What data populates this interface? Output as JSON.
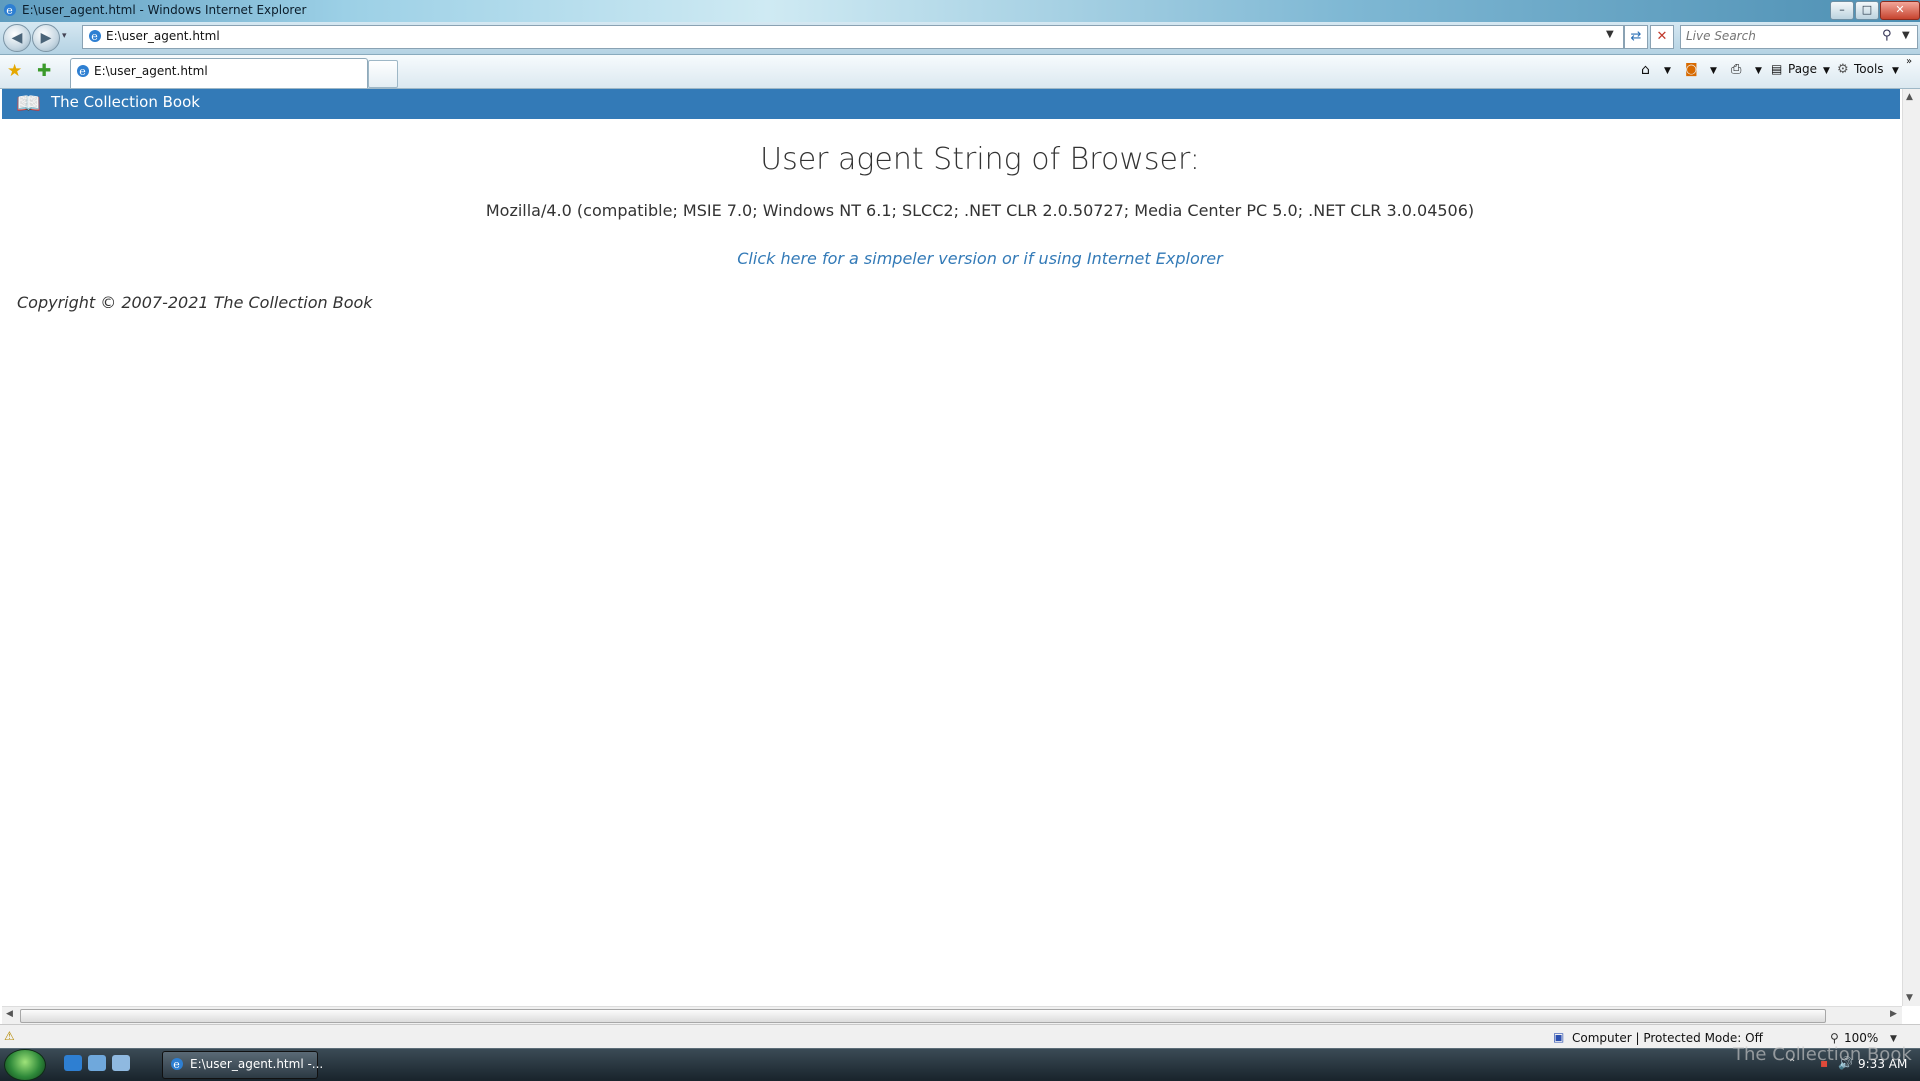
{
  "window": {
    "title": "E:\\user_agent.html - Windows Internet Explorer",
    "buttons": {
      "minimize": "–",
      "maximize": "□",
      "close": "✕"
    }
  },
  "navbar": {
    "address": "E:\\user_agent.html",
    "search_placeholder": "Live Search"
  },
  "tab": {
    "label": "E:\\user_agent.html"
  },
  "commands": {
    "page": "Page",
    "tools": "Tools"
  },
  "site": {
    "title": "The Collection Book",
    "heading": "User agent String of Browser:",
    "user_agent": "Mozilla/4.0 (compatible; MSIE 7.0; Windows NT 6.1; SLCC2; .NET CLR 2.0.50727; Media Center PC 5.0; .NET CLR 3.0.04506)",
    "simple_link": "Click here for a simpeler version or if using Internet Explorer",
    "copyright": "Copyright © 2007-2021 The Collection Book"
  },
  "statusbar": {
    "zone": "Computer | Protected Mode: Off",
    "zoom": "100%"
  },
  "taskbar": {
    "task_label": "E:\\user_agent.html -...",
    "clock": "9:33 AM"
  },
  "watermark": "The Collection Book",
  "colors": {
    "site_bar": "#337ab7",
    "link": "#337ab7"
  },
  "icons": [
    "ie-icon",
    "back-icon",
    "forward-icon",
    "refresh-icon",
    "stop-icon",
    "search-icon",
    "favorites-star-icon",
    "add-favorites-icon",
    "home-icon",
    "feeds-icon",
    "print-icon",
    "page-icon",
    "tools-gear-icon",
    "book-icon",
    "warning-icon",
    "computer-zone-icon",
    "zoom-icon",
    "start-orb-icon"
  ]
}
